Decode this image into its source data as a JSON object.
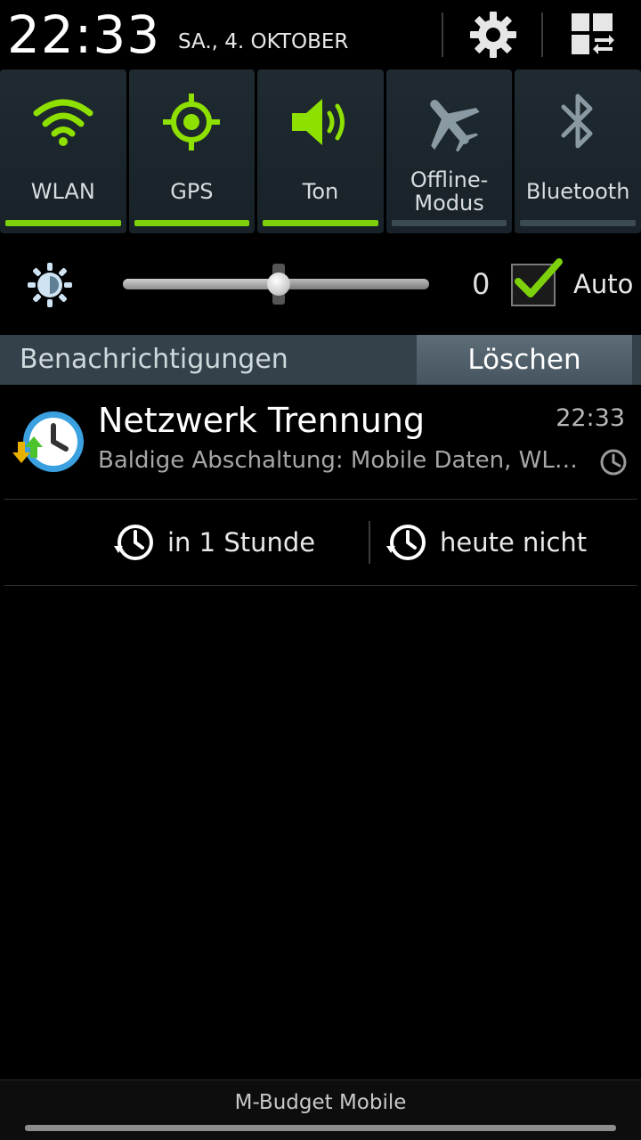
{
  "header": {
    "time": "22:33",
    "date": "SA., 4. OKTOBER",
    "settings_icon": "gear-icon",
    "grid_icon": "quick-settings-grid-icon"
  },
  "toggles": [
    {
      "label": "WLAN",
      "icon": "wifi-icon",
      "active": true
    },
    {
      "label": "GPS",
      "icon": "gps-icon",
      "active": true
    },
    {
      "label": "Ton",
      "icon": "speaker-icon",
      "active": true
    },
    {
      "label": "Offline-\nModus",
      "icon": "airplane-icon",
      "active": false
    },
    {
      "label": "Bluetooth",
      "icon": "bluetooth-icon",
      "active": false
    }
  ],
  "brightness": {
    "icon": "brightness-sun-icon",
    "value": "0",
    "level": 0.5,
    "auto_label": "Auto",
    "auto_checked": true
  },
  "notifications": {
    "header": "Benachrichtigungen",
    "clear_label": "Löschen",
    "items": [
      {
        "title": "Netzwerk Trennung",
        "time": "22:33",
        "text": "Baldige Abschaltung: Mobile Daten, WL…",
        "icon": "network-timer-app-icon"
      }
    ],
    "actions": [
      {
        "label": "in 1 Stunde",
        "icon": "snooze-icon"
      },
      {
        "label": "heute nicht",
        "icon": "snooze-icon"
      }
    ]
  },
  "footer": {
    "carrier": "M-Budget Mobile"
  },
  "colors": {
    "accent_green": "#7cd10c",
    "toggle_bg": "#1f2a31",
    "inactive_bar": "#3c4a52",
    "notif_header": "#34414a"
  }
}
